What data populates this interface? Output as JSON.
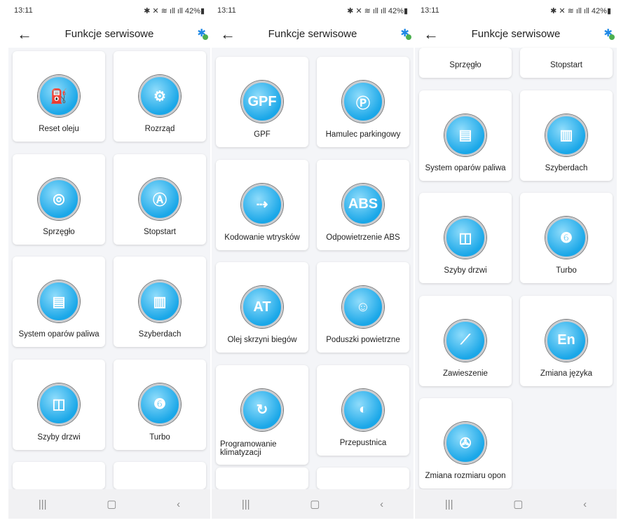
{
  "status": {
    "time": "13:11",
    "right": "✱ ✕ ≋ ıll ıll 42%▮"
  },
  "header": {
    "title": "Funkcje serwisowe",
    "back": "←",
    "bt": "✱"
  },
  "nav": {
    "recent": "|||",
    "home": "▢",
    "back": "‹"
  },
  "panels": [
    {
      "offset": 0,
      "items": [
        {
          "label": "Reset oleju",
          "glyph": "⛽"
        },
        {
          "label": "Rozrząd",
          "glyph": "⚙"
        },
        {
          "label": "Sprzęgło",
          "glyph": "◎"
        },
        {
          "label": "Stopstart",
          "glyph": "Ⓐ"
        },
        {
          "label": "System oparów paliwa",
          "glyph": "▤"
        },
        {
          "label": "Szyberdach",
          "glyph": "▥"
        },
        {
          "label": "Szyby drzwi",
          "glyph": "◫"
        },
        {
          "label": "Turbo",
          "glyph": "❻"
        },
        {
          "label": "",
          "glyph": ""
        },
        {
          "label": "",
          "glyph": ""
        }
      ]
    },
    {
      "offset": 8,
      "items": [
        {
          "label": "GPF",
          "glyph": "GPF"
        },
        {
          "label": "Hamulec parkingowy",
          "glyph": "Ⓟ"
        },
        {
          "label": "Kodowanie wtrysków",
          "glyph": "⇢"
        },
        {
          "label": "Odpowietrzenie ABS",
          "glyph": "ABS"
        },
        {
          "label": "Olej skrzyni biegów",
          "glyph": "AT"
        },
        {
          "label": "Poduszki powietrzne",
          "glyph": "☺"
        },
        {
          "label": "Programowanie klimatyzacji",
          "glyph": "↻"
        },
        {
          "label": "Przepustnica",
          "glyph": "◐"
        },
        {
          "label": "",
          "glyph": ""
        },
        {
          "label": "",
          "glyph": ""
        }
      ]
    },
    {
      "offset": -91,
      "items": [
        {
          "label": "Sprzęgło",
          "glyph": "◎"
        },
        {
          "label": "Stopstart",
          "glyph": "Ⓐ"
        },
        {
          "label": "System oparów paliwa",
          "glyph": "▤"
        },
        {
          "label": "Szyberdach",
          "glyph": "▥"
        },
        {
          "label": "Szyby drzwi",
          "glyph": "◫"
        },
        {
          "label": "Turbo",
          "glyph": "❻"
        },
        {
          "label": "Zawieszenie",
          "glyph": "⟋"
        },
        {
          "label": "Zmiana języka",
          "glyph": "En"
        },
        {
          "label": "Zmiana rozmiaru opon",
          "glyph": "✇"
        }
      ]
    }
  ]
}
